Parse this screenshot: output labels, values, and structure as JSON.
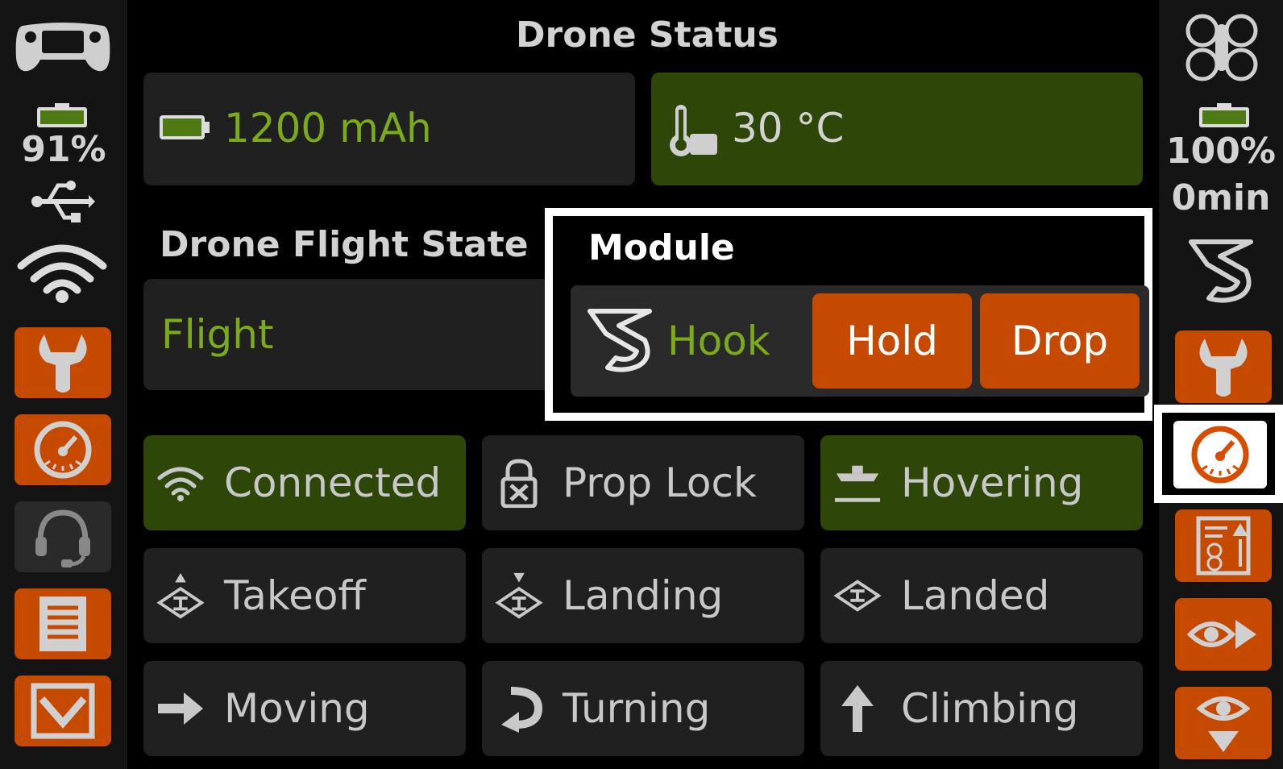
{
  "header": {
    "title": "Drone Status"
  },
  "controller": {
    "battery_percent": "91%"
  },
  "drone_side": {
    "battery_percent": "100%",
    "time_remaining": "0min"
  },
  "status_panels": {
    "battery_capacity": "1200 mAh",
    "temperature": "30 °C"
  },
  "flight_state": {
    "label": "Drone Flight State",
    "value": "Flight"
  },
  "module": {
    "title": "Module",
    "name": "Hook",
    "hold_label": "Hold",
    "drop_label": "Drop"
  },
  "status_tiles": [
    {
      "label": "Connected",
      "icon": "wifi-icon",
      "active": true
    },
    {
      "label": "Prop Lock",
      "icon": "lock-icon",
      "active": false
    },
    {
      "label": "Hovering",
      "icon": "hovering-icon",
      "active": true
    },
    {
      "label": "Takeoff",
      "icon": "takeoff-icon",
      "active": false
    },
    {
      "label": "Landing",
      "icon": "landing-icon",
      "active": false
    },
    {
      "label": "Landed",
      "icon": "landed-icon",
      "active": false
    },
    {
      "label": "Moving",
      "icon": "arrow-right-icon",
      "active": false
    },
    {
      "label": "Turning",
      "icon": "turn-icon",
      "active": false
    },
    {
      "label": "Climbing",
      "icon": "arrow-up-icon",
      "active": false
    }
  ],
  "left_nav": [
    "wrench-icon",
    "gauge-icon",
    "headset-icon",
    "document-icon",
    "download-icon"
  ],
  "right_nav": [
    "wrench-icon",
    "gauge-icon",
    "drone-info-icon",
    "eye-forward-icon",
    "eye-down-icon"
  ],
  "colors": {
    "accent_orange": "#c54a00",
    "active_green": "#2e4709",
    "text_green": "#7cab1a",
    "battery_green": "#4d7a12"
  }
}
